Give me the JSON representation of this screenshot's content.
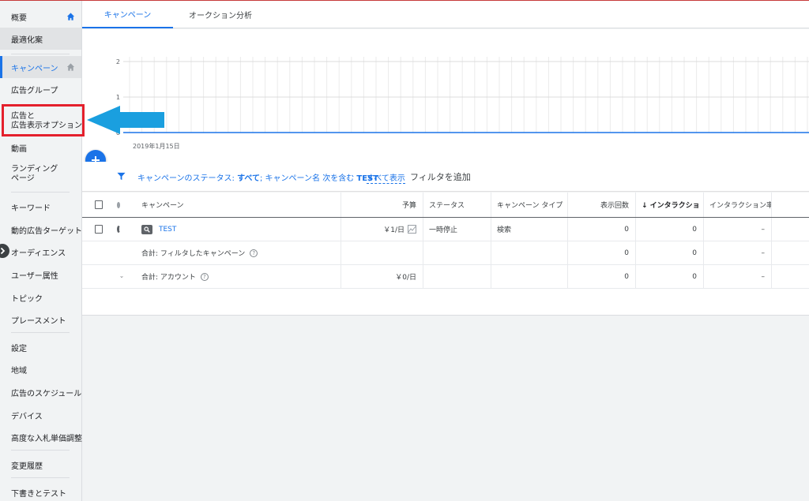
{
  "sidebar": {
    "items": [
      {
        "label": "概要"
      },
      {
        "label": "最適化案"
      },
      {
        "label": "キャンペーン"
      },
      {
        "label": "広告グループ"
      },
      {
        "label_line1": "広告と",
        "label_line2": "広告表示オプション"
      },
      {
        "label": "動画"
      },
      {
        "label_line1": "ランディング",
        "label_line2": "ページ"
      },
      {
        "label": "キーワード"
      },
      {
        "label": "動的広告ターゲット"
      },
      {
        "label": "オーディエンス"
      },
      {
        "label": "ユーザー属性"
      },
      {
        "label": "トピック"
      },
      {
        "label": "プレースメント"
      },
      {
        "label": "設定"
      },
      {
        "label": "地域"
      },
      {
        "label": "広告のスケジュール"
      },
      {
        "label": "デバイス"
      },
      {
        "label": "高度な入札単価調整"
      },
      {
        "label": "変更履歴"
      },
      {
        "label": "下書きとテスト"
      }
    ]
  },
  "tabs": [
    {
      "label": "キャンペーン"
    },
    {
      "label": "オークション分析"
    }
  ],
  "chart_data": {
    "type": "line",
    "x": [
      "2019年1月15日"
    ],
    "series": [
      {
        "values": [
          0
        ]
      }
    ],
    "yticks": [
      "2",
      "1",
      "0"
    ],
    "ylim": [
      0,
      2
    ],
    "xtick_label": "2019年1月15日",
    "grid": true
  },
  "filter": {
    "prefix": "キャンペーンのステータス: ",
    "status_value": "すべて",
    "middle": "; キャンペーン名 次を含む ",
    "name_value": "TEST",
    "show_all": "すべて表示",
    "add_filter": "フィルタを追加"
  },
  "table": {
    "headers": {
      "campaign": "キャンペーン",
      "budget": "予算",
      "status": "ステータス",
      "type": "キャンペーン タイプ",
      "impressions": "表示回数",
      "interactions": "↓ インタラクショ",
      "interaction_rate": "インタラクション率"
    },
    "rows": [
      {
        "campaign": "TEST",
        "budget": "￥1/日",
        "status": "一時停止",
        "type": "検索",
        "impressions": "0",
        "interactions": "0",
        "interaction_rate": "–"
      },
      {
        "campaign": "合計: フィルタしたキャンペーン",
        "budget": "",
        "status": "",
        "type": "",
        "impressions": "0",
        "interactions": "0",
        "interaction_rate": "–"
      },
      {
        "campaign": "合計: アカウント",
        "budget": "￥0/日",
        "status": "",
        "type": "",
        "impressions": "0",
        "interactions": "0",
        "interaction_rate": "–"
      }
    ]
  },
  "colors": {
    "accent": "#1a73e8",
    "highlight": "#e4202c",
    "arrow": "#1a9fdf"
  }
}
